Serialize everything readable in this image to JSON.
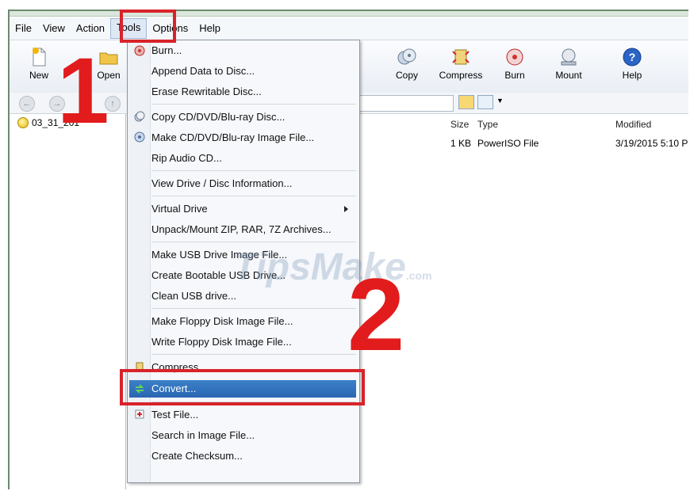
{
  "menubar": {
    "items": [
      "File",
      "View",
      "Action",
      "Tools",
      "Options",
      "Help"
    ],
    "active": "Tools"
  },
  "toolbar": {
    "new_label": "New",
    "open_label": "Open",
    "copy_label": "Copy",
    "compress_label": "Compress",
    "burn_label": "Burn",
    "mount_label": "Mount",
    "help_label": "Help"
  },
  "tree": {
    "item": "03_31_201"
  },
  "filelist": {
    "headers": {
      "size": "Size",
      "type": "Type",
      "modified": "Modified"
    },
    "row": {
      "size": "1 KB",
      "type": "PowerISO File",
      "modified": "3/19/2015 5:10 P"
    }
  },
  "tools_menu": {
    "burn": "Burn...",
    "append": "Append Data to Disc...",
    "erase": "Erase Rewritable Disc...",
    "copy_disc": "Copy CD/DVD/Blu-ray Disc...",
    "make_image": "Make CD/DVD/Blu-ray Image File...",
    "rip": "Rip Audio CD...",
    "view_info": "View Drive / Disc Information...",
    "virtual_drive": "Virtual Drive",
    "unpack": "Unpack/Mount ZIP, RAR, 7Z Archives...",
    "usb_image": "Make USB Drive Image File...",
    "bootable_usb": "Create Bootable USB Drive...",
    "clean_usb": "Clean USB drive...",
    "floppy_make": "Make Floppy Disk Image File...",
    "floppy_write": "Write Floppy Disk Image File...",
    "compress": "Compress...",
    "convert": "Convert...",
    "test": "Test File...",
    "search": "Search in Image File...",
    "checksum": "Create Checksum..."
  },
  "annotations": {
    "step1": "1",
    "step2": "2",
    "color": "#d8232a"
  },
  "watermark": {
    "main": "TipsMake",
    "suffix": ".com"
  }
}
